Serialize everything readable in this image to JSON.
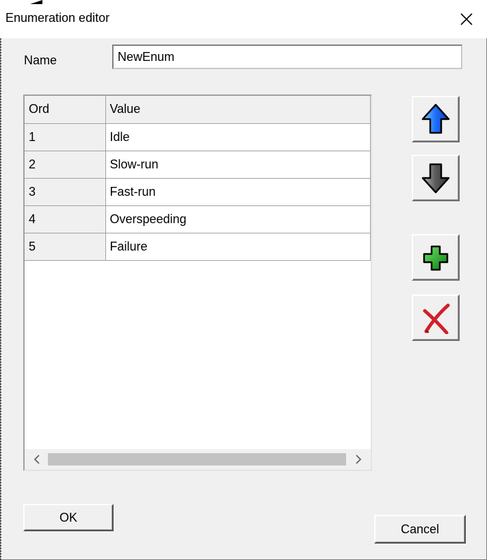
{
  "window": {
    "title": "Enumeration editor"
  },
  "name_field": {
    "label": "Name",
    "value": "NewEnum"
  },
  "grid": {
    "columns": [
      "Ord",
      "Value"
    ],
    "rows": [
      {
        "ord": "1",
        "value": "Idle"
      },
      {
        "ord": "2",
        "value": "Slow-run"
      },
      {
        "ord": "3",
        "value": "Fast-run"
      },
      {
        "ord": "4",
        "value": "Overspeeding"
      },
      {
        "ord": "5",
        "value": "Failure"
      }
    ]
  },
  "side_buttons": {
    "move_up": "arrow-up-icon",
    "move_down": "arrow-down-icon",
    "add": "plus-icon",
    "delete": "delete-x-icon"
  },
  "buttons": {
    "ok_label": "OK",
    "cancel_label": "Cancel"
  },
  "colors": {
    "up_arrow": "#1e6cff",
    "down_arrow": "#5a5a5a",
    "add": "#1fa51f",
    "delete": "#d0202a"
  }
}
